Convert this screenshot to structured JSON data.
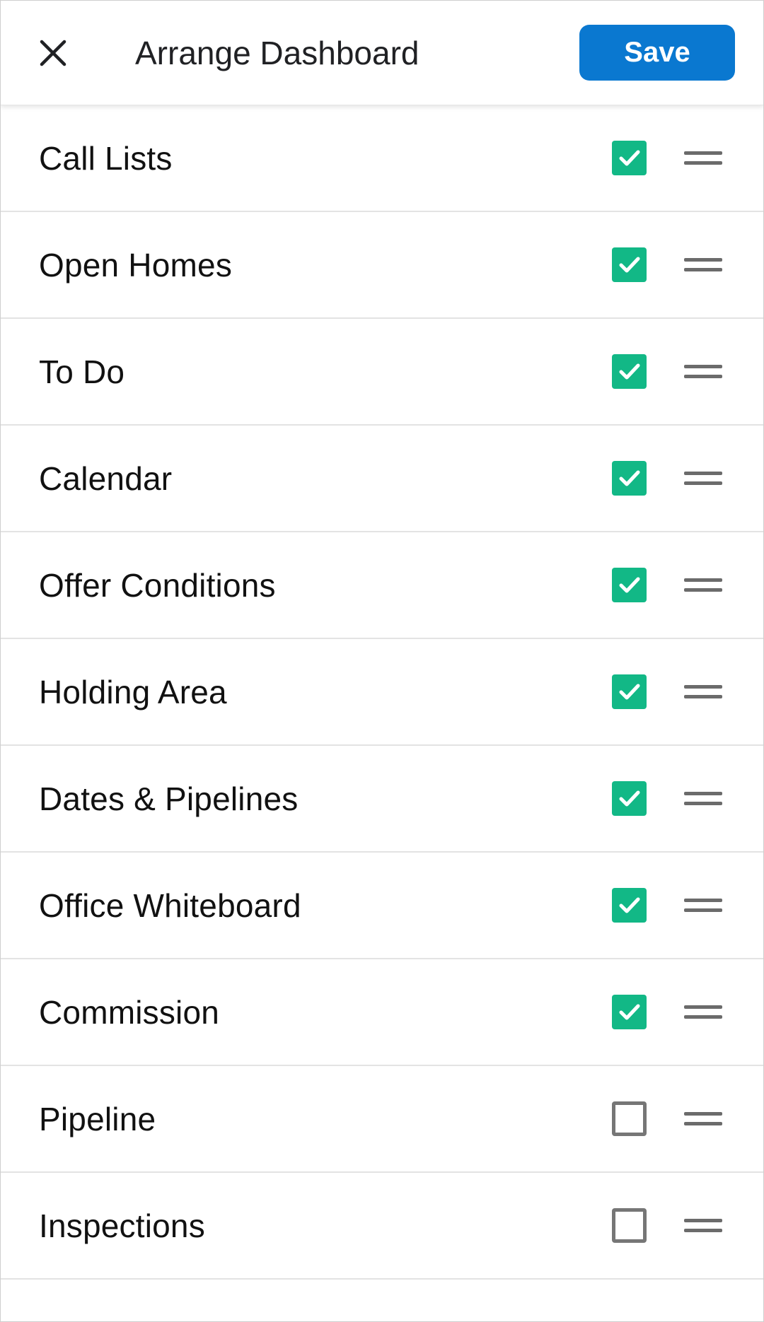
{
  "header": {
    "title": "Arrange Dashboard",
    "save_label": "Save",
    "close_icon": "close-icon"
  },
  "colors": {
    "save_button": "#0a78d0",
    "checkbox_checked": "#12b886",
    "checkbox_border_unchecked": "#767676",
    "drag_handle": "#6b6b6b"
  },
  "items": [
    {
      "label": "Call Lists",
      "checked": true
    },
    {
      "label": "Open Homes",
      "checked": true
    },
    {
      "label": "To Do",
      "checked": true
    },
    {
      "label": "Calendar",
      "checked": true
    },
    {
      "label": "Offer Conditions",
      "checked": true
    },
    {
      "label": "Holding Area",
      "checked": true
    },
    {
      "label": "Dates & Pipelines",
      "checked": true
    },
    {
      "label": "Office Whiteboard",
      "checked": true
    },
    {
      "label": "Commission",
      "checked": true
    },
    {
      "label": "Pipeline",
      "checked": false
    },
    {
      "label": "Inspections",
      "checked": false
    }
  ]
}
